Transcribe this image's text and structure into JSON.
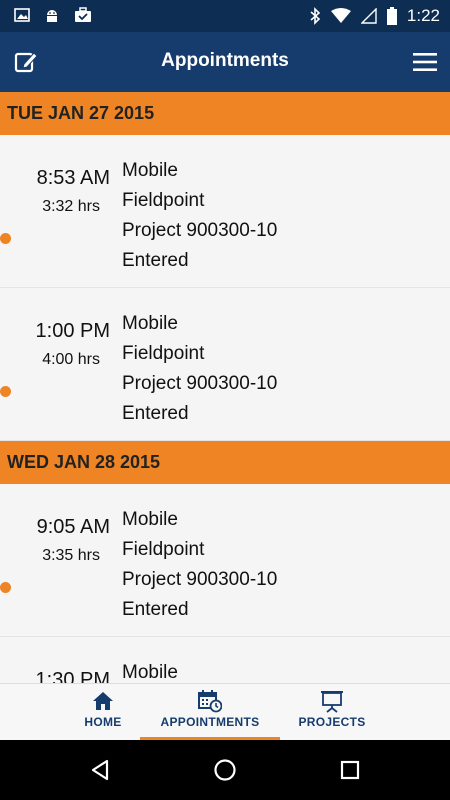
{
  "status": {
    "time": "1:22"
  },
  "appbar": {
    "title": "Appointments"
  },
  "days": [
    {
      "date": "TUE JAN 27 2015",
      "appointments": [
        {
          "time": "8:53 AM",
          "duration": "3:32 hrs",
          "lines": [
            "Mobile",
            "Fieldpoint",
            "Project 900300-10",
            "Entered"
          ]
        },
        {
          "time": "1:00 PM",
          "duration": "4:00 hrs",
          "lines": [
            "Mobile",
            "Fieldpoint",
            "Project 900300-10",
            "Entered"
          ]
        }
      ]
    },
    {
      "date": "WED JAN 28 2015",
      "appointments": [
        {
          "time": "9:05 AM",
          "duration": "3:35 hrs",
          "lines": [
            "Mobile",
            "Fieldpoint",
            "Project 900300-10",
            "Entered"
          ]
        },
        {
          "time": "1:30 PM",
          "duration": "",
          "lines": [
            "Mobile",
            "",
            "",
            ""
          ]
        }
      ]
    }
  ],
  "tabs": [
    {
      "label": "HOME",
      "icon": "home-icon"
    },
    {
      "label": "APPOINTMENTS",
      "icon": "calendar-clock-icon"
    },
    {
      "label": "PROJECTS",
      "icon": "presentation-board-icon"
    }
  ],
  "colors": {
    "primary": "#163c6e",
    "statusbar": "#0d2d52",
    "accent": "#ee8424"
  }
}
